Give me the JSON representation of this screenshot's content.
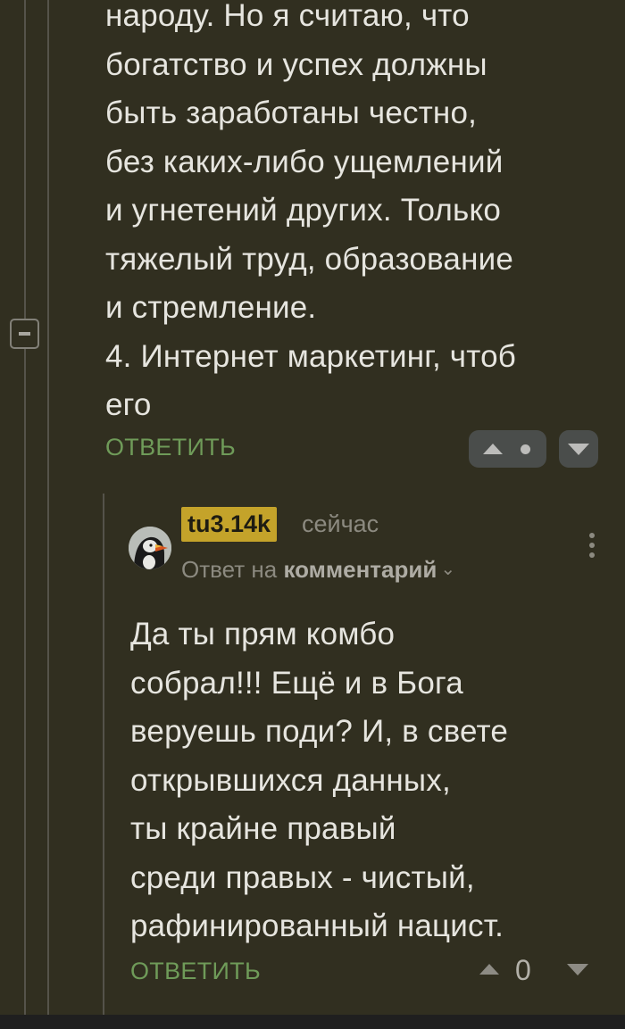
{
  "parent_comment": {
    "text": "народу. Но я считаю, что\nбогатство и успех должны\nбыть заработаны честно,\nбез каких-либо ущемлений\nи угнетений других. Только\nтяжелый труд, образование\nи стремление.\n4. Интернет маркетинг, чтоб\nего",
    "reply_label": "ОТВЕТИТЬ"
  },
  "reply_comment": {
    "username": "tu3.14k",
    "time": "сейчас",
    "reply_to_prefix": "Ответ на",
    "reply_to_link": "комментарий",
    "chevron": "⌄",
    "text": "Да ты прям комбо\nсобрал!!! Ещё и в Бога\nверуешь поди? И, в свете\nоткрывшихся данных,\nты крайне правый\nсреди правых - чистый,\nрафинированный нацист.",
    "reply_label": "ОТВЕТИТЬ",
    "score": "0"
  },
  "icons": {
    "collapse": "minus-square-icon",
    "upvote": "triangle-up-icon",
    "downvote": "triangle-down-icon",
    "more": "kebab-vertical-icon",
    "avatar": "puffin-avatar"
  },
  "colors": {
    "background": "#312f20",
    "accent_green": "#6f9b59",
    "username_badge": "#c4a32a",
    "vote_pill": "#4a4d4b"
  }
}
